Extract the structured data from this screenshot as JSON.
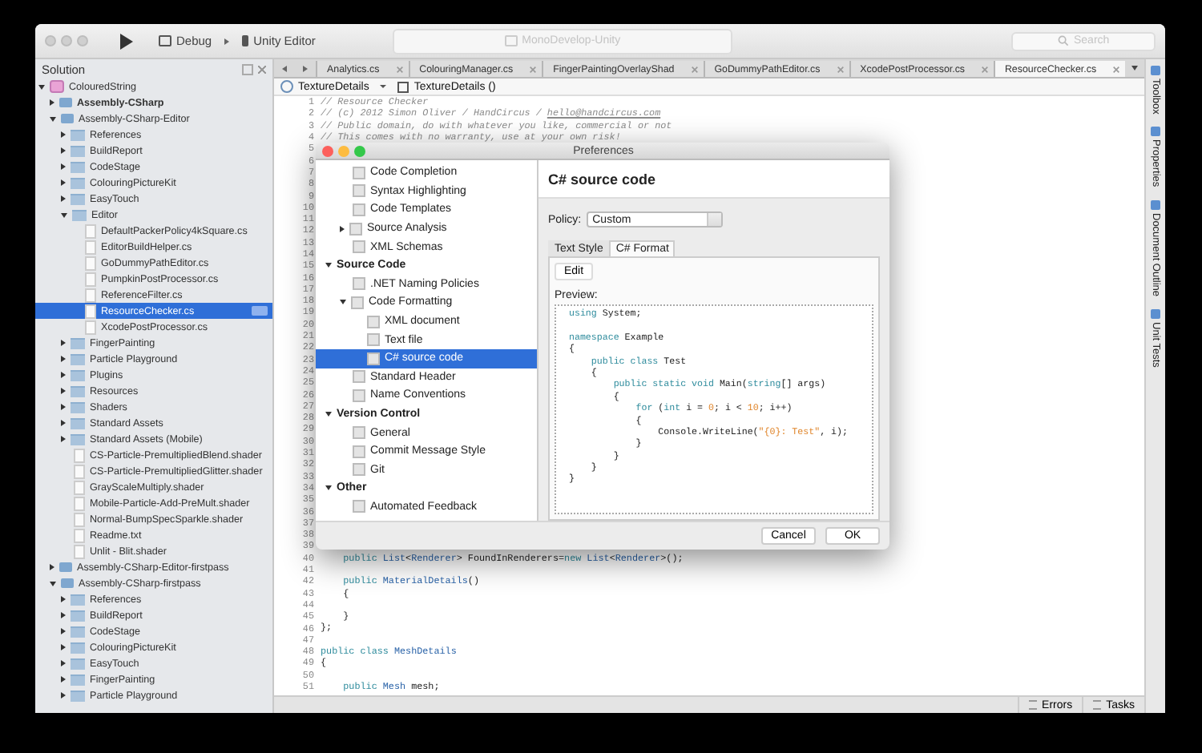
{
  "window": {
    "title": "MonoDevelop-Unity"
  },
  "toolbar": {
    "configuration": "Debug",
    "target": "Unity Editor",
    "search": {
      "placeholder": "Search"
    }
  },
  "solution": {
    "title": "Solution",
    "tree": [
      {
        "label": "ColouredString",
        "kind": "solution",
        "expanded": true,
        "selected": false,
        "children": [
          {
            "label": "Assembly-CSharp",
            "kind": "project",
            "startup": true,
            "expanded": false,
            "selected": false
          },
          {
            "label": "Assembly-CSharp-Editor",
            "kind": "project",
            "startup": false,
            "expanded": true,
            "selected": false,
            "children": [
              {
                "label": "References",
                "kind": "folder",
                "expanded": false,
                "selected": false
              },
              {
                "label": "BuildReport",
                "kind": "folder",
                "expanded": false,
                "selected": false
              },
              {
                "label": "CodeStage",
                "kind": "folder",
                "expanded": false,
                "selected": false
              },
              {
                "label": "ColouringPictureKit",
                "kind": "folder",
                "expanded": false,
                "selected": false
              },
              {
                "label": "EasyTouch",
                "kind": "folder",
                "expanded": false,
                "selected": false
              },
              {
                "label": "Editor",
                "kind": "folder",
                "expanded": true,
                "selected": false,
                "children": [
                  {
                    "label": "DefaultPackerPolicy4kSquare.cs",
                    "kind": "file",
                    "selected": false
                  },
                  {
                    "label": "EditorBuildHelper.cs",
                    "kind": "file",
                    "selected": false
                  },
                  {
                    "label": "GoDummyPathEditor.cs",
                    "kind": "file",
                    "selected": false
                  },
                  {
                    "label": "PumpkinPostProcessor.cs",
                    "kind": "file",
                    "selected": false
                  },
                  {
                    "label": "ReferenceFilter.cs",
                    "kind": "file",
                    "selected": false
                  },
                  {
                    "label": "ResourceChecker.cs",
                    "kind": "file",
                    "selected": true
                  },
                  {
                    "label": "XcodePostProcessor.cs",
                    "kind": "file",
                    "selected": false
                  }
                ]
              },
              {
                "label": "FingerPainting",
                "kind": "folder",
                "expanded": false,
                "selected": false
              },
              {
                "label": "Particle Playground",
                "kind": "folder",
                "expanded": false,
                "selected": false
              },
              {
                "label": "Plugins",
                "kind": "folder",
                "expanded": false,
                "selected": false
              },
              {
                "label": "Resources",
                "kind": "folder",
                "expanded": false,
                "selected": false
              },
              {
                "label": "Shaders",
                "kind": "folder",
                "expanded": false,
                "selected": false
              },
              {
                "label": "Standard Assets",
                "kind": "folder",
                "expanded": false,
                "selected": false
              },
              {
                "label": "Standard Assets (Mobile)",
                "kind": "folder",
                "expanded": false,
                "selected": false
              },
              {
                "label": "CS-Particle-PremultipliedBlend.shader",
                "kind": "file",
                "selected": false
              },
              {
                "label": "CS-Particle-PremultipliedGlitter.shader",
                "kind": "file",
                "selected": false
              },
              {
                "label": "GrayScaleMultiply.shader",
                "kind": "file",
                "selected": false
              },
              {
                "label": "Mobile-Particle-Add-PreMult.shader",
                "kind": "file",
                "selected": false
              },
              {
                "label": "Normal-BumpSpecSparkle.shader",
                "kind": "file",
                "selected": false
              },
              {
                "label": "Readme.txt",
                "kind": "file",
                "selected": false
              },
              {
                "label": "Unlit - Blit.shader",
                "kind": "file",
                "selected": false
              }
            ]
          },
          {
            "label": "Assembly-CSharp-Editor-firstpass",
            "kind": "project",
            "startup": false,
            "expanded": false,
            "selected": false
          },
          {
            "label": "Assembly-CSharp-firstpass",
            "kind": "project",
            "startup": false,
            "expanded": true,
            "selected": false,
            "children": [
              {
                "label": "References",
                "kind": "folder",
                "expanded": false,
                "selected": false
              },
              {
                "label": "BuildReport",
                "kind": "folder",
                "expanded": false,
                "selected": false
              },
              {
                "label": "CodeStage",
                "kind": "folder",
                "expanded": false,
                "selected": false
              },
              {
                "label": "ColouringPictureKit",
                "kind": "folder",
                "expanded": false,
                "selected": false
              },
              {
                "label": "EasyTouch",
                "kind": "folder",
                "expanded": false,
                "selected": false
              },
              {
                "label": "FingerPainting",
                "kind": "folder",
                "expanded": false,
                "selected": false
              },
              {
                "label": "Particle Playground",
                "kind": "folder",
                "expanded": false,
                "selected": false
              }
            ]
          }
        ]
      }
    ]
  },
  "editor": {
    "tabs": [
      {
        "label": "Analytics.cs",
        "selected": false
      },
      {
        "label": "ColouringManager.cs",
        "selected": false
      },
      {
        "label": "FingerPaintingOverlayShad",
        "selected": false
      },
      {
        "label": "GoDummyPathEditor.cs",
        "selected": false
      },
      {
        "label": "XcodePostProcessor.cs",
        "selected": false
      },
      {
        "label": "ResourceChecker.cs",
        "selected": true
      }
    ],
    "breadcrumb": [
      "TextureDetails",
      "TextureDetails ()"
    ],
    "lines": [
      {
        "number": "1",
        "tokens": [
          {
            "text": "// Resource Checker",
            "kind": "comment"
          }
        ]
      },
      {
        "number": "2",
        "tokens": [
          {
            "text": "// (c) 2012 Simon Oliver / HandCircus / ",
            "kind": "comment"
          },
          {
            "text": "hello@handcircus.com",
            "kind": "link"
          }
        ]
      },
      {
        "number": "3",
        "tokens": [
          {
            "text": "// Public domain, do with whatever you like, commercial or not",
            "kind": "comment"
          }
        ]
      },
      {
        "number": "4",
        "tokens": [
          {
            "text": "// This comes with no warranty, use at your own risk!",
            "kind": "comment"
          }
        ]
      },
      {
        "number": "5"
      },
      {
        "number": "6"
      },
      {
        "number": "7"
      },
      {
        "number": "8"
      },
      {
        "number": "9"
      },
      {
        "number": "10"
      },
      {
        "number": "11"
      },
      {
        "number": "12"
      },
      {
        "number": "13"
      },
      {
        "number": "14"
      },
      {
        "number": "15"
      },
      {
        "number": "16"
      },
      {
        "number": "17"
      },
      {
        "number": "18"
      },
      {
        "number": "19"
      },
      {
        "number": "20"
      },
      {
        "number": "21"
      },
      {
        "number": "22"
      },
      {
        "number": "23"
      },
      {
        "number": "24"
      },
      {
        "number": "25"
      },
      {
        "number": "26"
      },
      {
        "number": "27"
      },
      {
        "number": "28"
      },
      {
        "number": "29"
      },
      {
        "number": "30"
      },
      {
        "number": "31"
      },
      {
        "number": "32"
      },
      {
        "number": "33"
      },
      {
        "number": "34"
      },
      {
        "number": "35"
      },
      {
        "number": "36"
      },
      {
        "number": "37"
      },
      {
        "number": "38"
      },
      {
        "number": "39"
      },
      {
        "number": "40",
        "tokens": [
          {
            "text": "    public ",
            "kind": "keyword"
          },
          {
            "text": "List",
            "kind": "type"
          },
          {
            "text": "<",
            "kind": "plain"
          },
          {
            "text": "Renderer",
            "kind": "type"
          },
          {
            "text": "> FoundInRenderers=",
            "kind": "plain"
          },
          {
            "text": "new ",
            "kind": "keyword"
          },
          {
            "text": "List",
            "kind": "type"
          },
          {
            "text": "<",
            "kind": "plain"
          },
          {
            "text": "Renderer",
            "kind": "type"
          },
          {
            "text": ">();",
            "kind": "plain"
          }
        ]
      },
      {
        "number": "41"
      },
      {
        "number": "42",
        "tokens": [
          {
            "text": "    public ",
            "kind": "keyword"
          },
          {
            "text": "MaterialDetails",
            "kind": "type"
          },
          {
            "text": "()",
            "kind": "plain"
          }
        ]
      },
      {
        "number": "43",
        "tokens": [
          {
            "text": "    {",
            "kind": "plain"
          }
        ]
      },
      {
        "number": "44"
      },
      {
        "number": "45",
        "tokens": [
          {
            "text": "    }",
            "kind": "plain"
          }
        ]
      },
      {
        "number": "46",
        "tokens": [
          {
            "text": "};",
            "kind": "plain"
          }
        ]
      },
      {
        "number": "47"
      },
      {
        "number": "48",
        "tokens": [
          {
            "text": "public class ",
            "kind": "keyword"
          },
          {
            "text": "MeshDetails",
            "kind": "type"
          }
        ]
      },
      {
        "number": "49",
        "tokens": [
          {
            "text": "{",
            "kind": "plain"
          }
        ]
      },
      {
        "number": "50"
      },
      {
        "number": "51",
        "tokens": [
          {
            "text": "    public ",
            "kind": "keyword"
          },
          {
            "text": "Mesh",
            "kind": "type"
          },
          {
            "text": " mesh;",
            "kind": "plain"
          }
        ]
      }
    ]
  },
  "side_pads": [
    "Toolbox",
    "Properties",
    "Document Outline",
    "Unit Tests"
  ],
  "status_bar": [
    "Errors",
    "Tasks"
  ],
  "preferences": {
    "title": "Preferences",
    "sections": [
      {
        "children": [
          {
            "label": "Code Completion",
            "selected": false
          },
          {
            "label": "Syntax Highlighting",
            "selected": false
          },
          {
            "label": "Code Templates",
            "selected": false
          },
          {
            "label": "Source Analysis",
            "expanded": false,
            "selected": false
          },
          {
            "label": "XML Schemas",
            "selected": false
          }
        ]
      },
      {
        "label": "Source Code",
        "expanded": true,
        "children": [
          {
            "label": ".NET Naming Policies",
            "selected": false
          },
          {
            "label": "Code Formatting",
            "expanded": true,
            "selected": false,
            "children": [
              {
                "label": "XML document",
                "selected": false
              },
              {
                "label": "Text file",
                "selected": false
              },
              {
                "label": "C# source code",
                "selected": true
              }
            ]
          },
          {
            "label": "Standard Header",
            "selected": false
          },
          {
            "label": "Name Conventions",
            "selected": false
          }
        ]
      },
      {
        "label": "Version Control",
        "expanded": true,
        "children": [
          {
            "label": "General",
            "selected": false
          },
          {
            "label": "Commit Message Style",
            "selected": false
          },
          {
            "label": "Git",
            "selected": false
          }
        ]
      },
      {
        "label": "Other",
        "expanded": true,
        "children": [
          {
            "label": "Automated Feedback",
            "selected": false
          }
        ]
      }
    ],
    "page_title": "C# source code",
    "policy_label": "Policy:",
    "policy": "Custom",
    "tabs": [
      {
        "label": "Text Style",
        "selected": false
      },
      {
        "label": "C# Format",
        "selected": true
      }
    ],
    "edit_button": "Edit",
    "preview_label": "Preview:",
    "preview_lines": [
      [
        {
          "text": "using ",
          "kind": "keyword"
        },
        {
          "text": "System;",
          "kind": "plain"
        }
      ],
      [
        {
          "text": "namespace ",
          "kind": "keyword",
          "gap_before": true
        },
        {
          "text": "Example",
          "kind": "plain"
        }
      ],
      [
        {
          "text": "{",
          "kind": "plain"
        }
      ],
      [
        {
          "text": "    public class ",
          "kind": "keyword"
        },
        {
          "text": "Test",
          "kind": "plain"
        }
      ],
      [
        {
          "text": "    {",
          "kind": "plain"
        }
      ],
      [
        {
          "text": "        public static void ",
          "kind": "keyword"
        },
        {
          "text": "Main(",
          "kind": "plain"
        },
        {
          "text": "string",
          "kind": "keyword"
        },
        {
          "text": "[] args)",
          "kind": "plain"
        }
      ],
      [
        {
          "text": "        {",
          "kind": "plain"
        }
      ],
      [
        {
          "text": "            for ",
          "kind": "keyword"
        },
        {
          "text": "(",
          "kind": "plain"
        },
        {
          "text": "int",
          "kind": "keyword"
        },
        {
          "text": " i = ",
          "kind": "plain"
        },
        {
          "text": "0",
          "kind": "number"
        },
        {
          "text": "; i < ",
          "kind": "plain"
        },
        {
          "text": "10",
          "kind": "number"
        },
        {
          "text": "; i++)",
          "kind": "plain"
        }
      ],
      [
        {
          "text": "            {",
          "kind": "plain"
        }
      ],
      [
        {
          "text": "                Console.WriteLine(",
          "kind": "plain"
        },
        {
          "text": "\"{0}: Test\"",
          "kind": "string"
        },
        {
          "text": ", i);",
          "kind": "plain"
        }
      ],
      [
        {
          "text": "            }",
          "kind": "plain"
        }
      ],
      [
        {
          "text": "        }",
          "kind": "plain"
        }
      ],
      [
        {
          "text": "    }",
          "kind": "plain"
        }
      ],
      [
        {
          "text": "}",
          "kind": "plain"
        }
      ]
    ],
    "buttons": [
      "Cancel",
      "OK"
    ]
  }
}
